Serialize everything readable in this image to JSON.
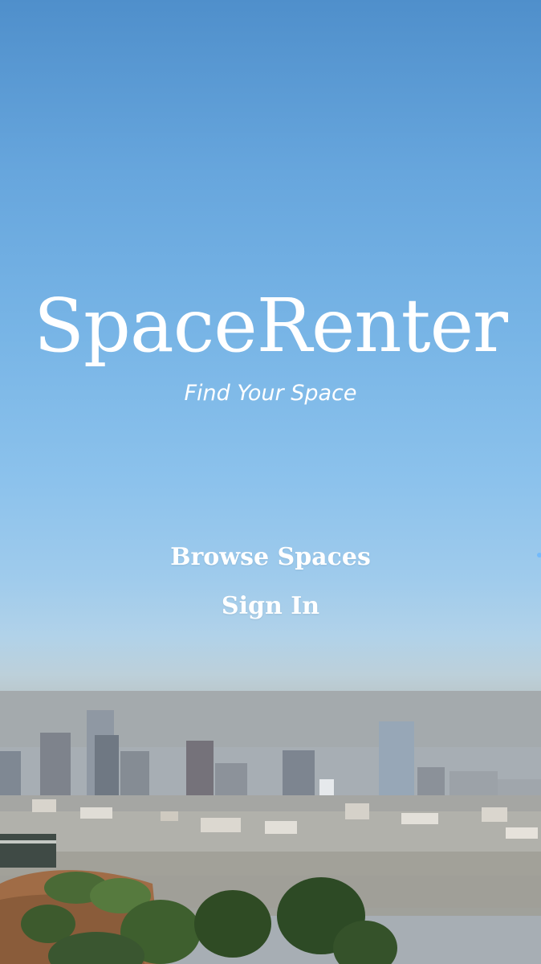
{
  "app": {
    "title": "SpaceRenter",
    "tagline": "Find Your Space"
  },
  "menu": {
    "browse_label": "Browse Spaces",
    "signin_label": "Sign In"
  },
  "background": {
    "image": "city skyline under blue sky",
    "sky_color": "#67a6dd",
    "haze_color": "#a9adaa"
  }
}
